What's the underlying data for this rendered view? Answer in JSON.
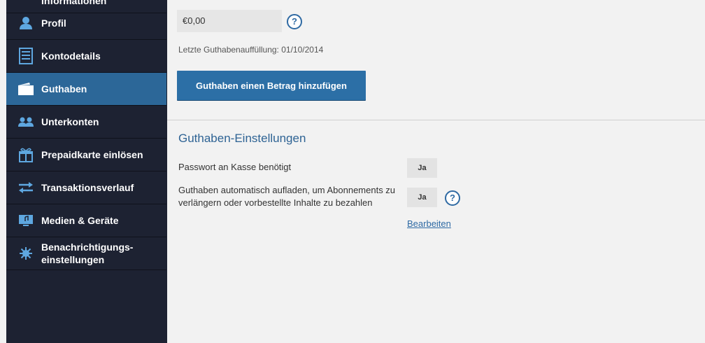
{
  "sidebar": {
    "items": [
      {
        "label": "Informationen",
        "icon": "info-icon"
      },
      {
        "label": "Profil",
        "icon": "profile-icon"
      },
      {
        "label": "Kontodetails",
        "icon": "account-details-icon"
      },
      {
        "label": "Guthaben",
        "icon": "wallet-icon",
        "active": true
      },
      {
        "label": "Unterkonten",
        "icon": "subaccounts-icon"
      },
      {
        "label": "Prepaidkarte einlösen",
        "icon": "gift-icon"
      },
      {
        "label": "Transaktionsverlauf",
        "icon": "transfer-arrows-icon"
      },
      {
        "label": "Medien & Geräte",
        "icon": "media-devices-icon"
      },
      {
        "label": "Benachrichtigungs-\neinstellungen",
        "icon": "notification-gear-icon"
      }
    ]
  },
  "balance": {
    "value": "€0,00",
    "last_topup": "Letzte Guthabenauffüllung: 01/10/2014",
    "add_button_label": "Guthaben einen Betrag hinzufügen"
  },
  "settings": {
    "title": "Guthaben-Einstellungen",
    "rows": [
      {
        "label": "Passwort an Kasse benötigt",
        "value": "Ja"
      },
      {
        "label": "Guthaben automatisch aufladen, um Abonnements zu verlängern oder vorbestellte Inhalte zu bezahlen",
        "value": "Ja"
      }
    ],
    "edit_label": "Bearbeiten"
  },
  "colors": {
    "sidebar_bg": "#1d2232",
    "active_item": "#2c6798",
    "accent": "#2c6fa6",
    "title_blue": "#2e6394"
  }
}
